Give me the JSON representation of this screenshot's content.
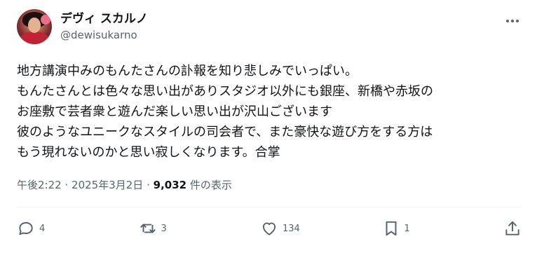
{
  "user": {
    "display_name": "デヴィ スカルノ",
    "handle": "@dewisukarno"
  },
  "post": {
    "lines": [
      "地方講演中みのもんたさんの訃報を知り悲しみでいっぱい。",
      "もんたさんとは色々な思い出がありスタジオ以外にも銀座、新橋や赤坂の",
      "お座敷で芸者衆と遊んだ楽しい思い出が沢山ございます",
      "彼のようなユニークなスタイルの司会者で、また豪快な遊び方をする方は",
      "もう現れないのかと思い寂しくなります。合掌"
    ],
    "time": "午後2:22",
    "date": "2025年3月2日",
    "separator": "·",
    "views_count": "9,032",
    "views_label": "件の表示"
  },
  "actions": {
    "replies": "4",
    "reposts": "3",
    "likes": "134",
    "bookmarks": "1"
  },
  "icons": {
    "more": "more-dots-icon",
    "reply": "reply-bubble-icon",
    "repost": "repost-arrows-icon",
    "like": "heart-icon",
    "bookmark": "bookmark-icon",
    "share": "share-upload-icon"
  }
}
